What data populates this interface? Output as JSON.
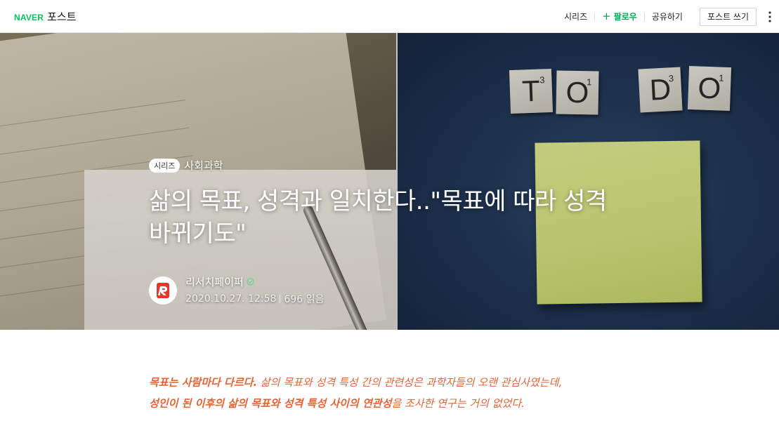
{
  "header": {
    "brand_naver": "NAVER",
    "brand_post": "포스트",
    "nav": {
      "series": "시리즈",
      "follow": "팔로우",
      "share": "공유하기",
      "write": "포스트 쓰기"
    }
  },
  "hero": {
    "series_badge": "시리즈",
    "series_name": "사회과학",
    "title_line1": "삶의 목표, 성격과 일치한다..\"목표에 따라 성격",
    "title_line2": "바뀌기도\"",
    "author": {
      "name": "리서치페이퍼",
      "date": "2020.10.27. 12:58",
      "views": "696 읽음"
    },
    "tiles": [
      "T",
      "O",
      "D",
      "O"
    ],
    "tile_scores": [
      "3",
      "1",
      "3",
      "1"
    ]
  },
  "article": {
    "intro_bold1": "목표는 사람마다 다르다.",
    "intro_text1": " 삶의 목표와 성격 특성 간의 관련성은 과학자들의 오랜 관심사였는데,",
    "intro_bold2": "성인이 된 이후의 삶의 목표와 성격 특성 사이의 연관성",
    "intro_text2": "을 조사한 연구는 거의 없었다."
  },
  "colors": {
    "brand_green": "#03c75a",
    "follow_green": "#03a94f",
    "intro_orange": "#e56436",
    "avatar_red": "#e8352b"
  },
  "icons": {
    "more": "vertical-dots-icon",
    "follow": "plus-icon",
    "author_badge": "verified-badge-icon"
  }
}
